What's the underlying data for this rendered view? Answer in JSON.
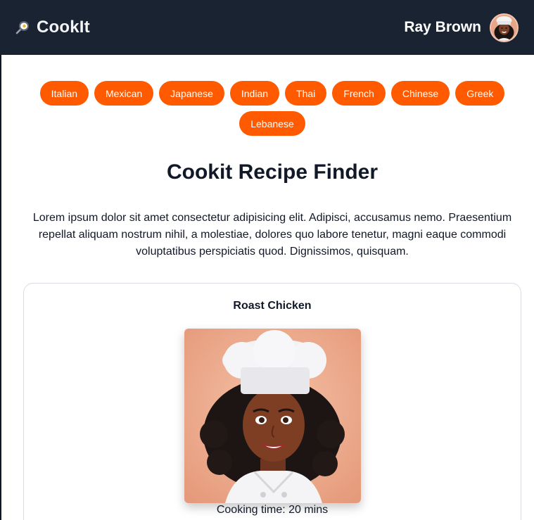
{
  "header": {
    "brand": "CookIt",
    "brand_icon": "frying-pan-egg-icon",
    "user_name": "Ray Brown",
    "avatar": "chef-avatar-icon",
    "background_color": "#1a2332"
  },
  "cuisines": [
    "Italian",
    "Mexican",
    "Japanese",
    "Indian",
    "Thai",
    "French",
    "Chinese",
    "Greek",
    "Lebanese"
  ],
  "accent_color": "#ff5a00",
  "main": {
    "title": "Cookit Recipe Finder",
    "intro": "Lorem ipsum dolor sit amet consectetur adipisicing elit. Adipisci, accusamus nemo. Praesentium repellat aliquam nostrum nihil, a molestiae, dolores quo labore tenetur, magni eaque commodi voluptatibus perspiciatis quod. Dignissimos, quisquam."
  },
  "recipe_card": {
    "title": "Roast Chicken",
    "image": "chef-portrait-image",
    "cooking_time": "Cooking time: 20 mins"
  }
}
